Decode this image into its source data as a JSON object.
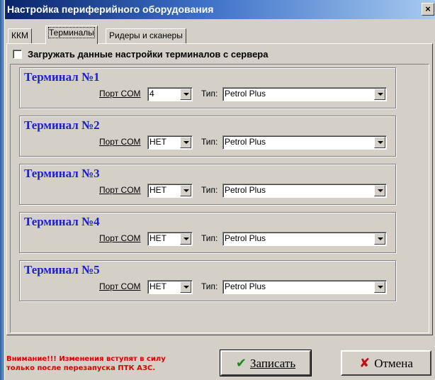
{
  "window": {
    "title": "Настройка периферийного оборудования",
    "close_label": "×"
  },
  "tabs": [
    {
      "label": "ККМ"
    },
    {
      "label": "Терминалы",
      "active": true
    },
    {
      "label": "Ридеры и сканеры"
    }
  ],
  "load_from_server": {
    "label": "Загружать данные настройки терминалов с сервера",
    "checked": false
  },
  "terminals": [
    {
      "title": "Терминал №1",
      "port_label": "Порт COM",
      "port_value": "4",
      "type_label": "Тип:",
      "type_value": "Petrol Plus"
    },
    {
      "title": "Терминал №2",
      "port_label": "Порт COM",
      "port_value": "НЕТ",
      "type_label": "Тип:",
      "type_value": "Petrol Plus"
    },
    {
      "title": "Терминал №3",
      "port_label": "Порт COM",
      "port_value": "НЕТ",
      "type_label": "Тип:",
      "type_value": "Petrol Plus"
    },
    {
      "title": "Терминал №4",
      "port_label": "Порт COM",
      "port_value": "НЕТ",
      "type_label": "Тип:",
      "type_value": "Petrol Plus"
    },
    {
      "title": "Терминал №5",
      "port_label": "Порт COM",
      "port_value": "НЕТ",
      "type_label": "Тип:",
      "type_value": "Petrol Plus"
    }
  ],
  "footer": {
    "warning_line1": "Внимание!!! Изменения вступят в силу",
    "warning_line2": "только после перезапуска ПТК АЗС.",
    "save_label": "Записать",
    "cancel_label": "Отмена"
  },
  "colors": {
    "terminal_title": "#1c1cd8",
    "warning": "#e00000",
    "save_icon": "#1a8a1a",
    "cancel_icon": "#c01010"
  },
  "icons": {
    "save": "check-icon",
    "cancel": "x-icon",
    "close": "close-icon",
    "combo_arrow": "chevron-down-icon"
  }
}
